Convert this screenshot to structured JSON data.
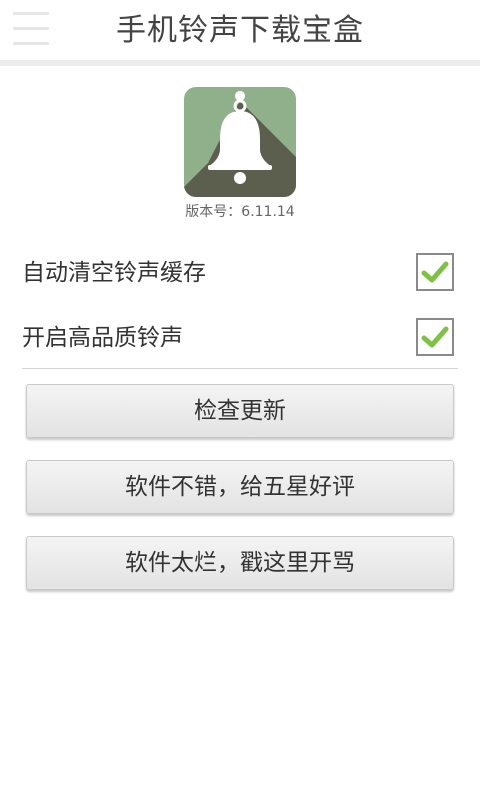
{
  "header": {
    "title": "手机铃声下载宝盒",
    "menu_icon": "hamburger-menu-icon"
  },
  "app": {
    "icon": "bell-icon",
    "version_label": "版本号：6.11.14",
    "colors": {
      "icon_bg": "#8fb08a",
      "icon_shadow": "#5c5f4e",
      "accent_check": "#7dc242"
    }
  },
  "settings": [
    {
      "label": "自动清空铃声缓存",
      "checked": true
    },
    {
      "label": "开启高品质铃声",
      "checked": true
    }
  ],
  "buttons": {
    "check_update": "检查更新",
    "rate_good": "软件不错，给五星好评",
    "rate_bad": "软件太烂，戳这里开骂"
  }
}
